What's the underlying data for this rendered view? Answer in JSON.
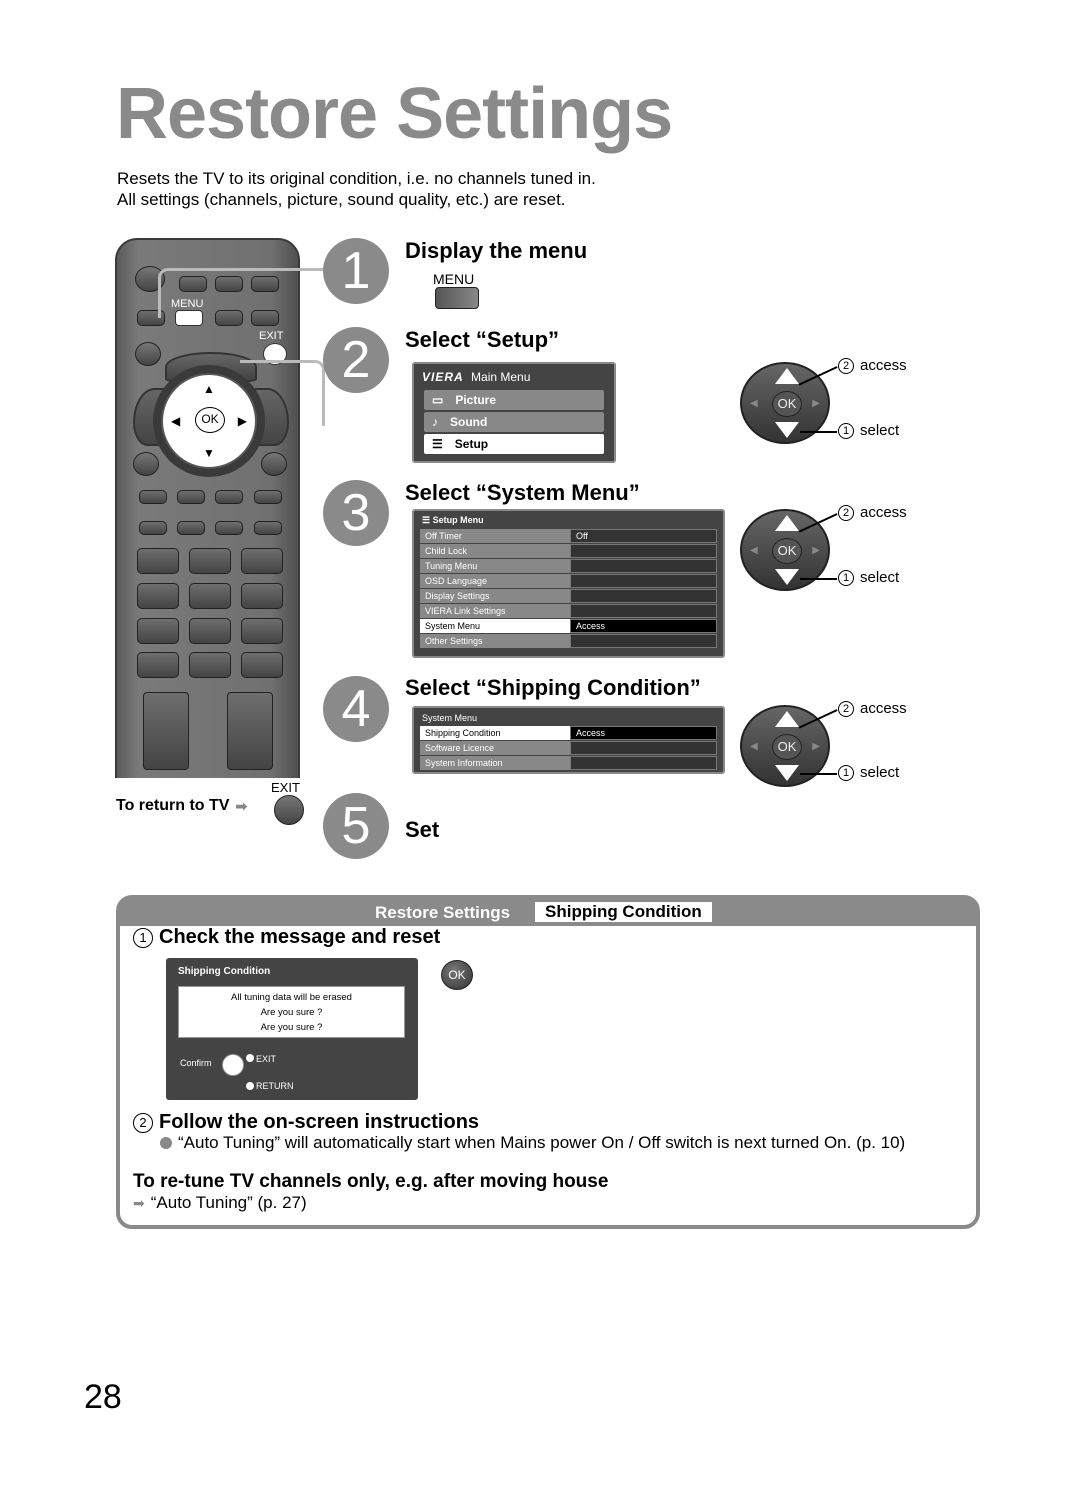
{
  "page": {
    "title": "Restore Settings",
    "intro": [
      "Resets the TV to its original condition, i.e. no channels tuned in.",
      "All settings (channels, picture, sound quality, etc.) are reset."
    ],
    "page_number": "28"
  },
  "remote": {
    "menu_label": "MENU",
    "exit_label": "EXIT",
    "ok_label": "OK",
    "return_to_tv": "To return to TV",
    "return_exit_label": "EXIT"
  },
  "steps": [
    {
      "number": "1",
      "title": "Display the menu",
      "key_label": "MENU"
    },
    {
      "number": "2",
      "title": "Select “Setup”"
    },
    {
      "number": "3",
      "title": "Select “System Menu”"
    },
    {
      "number": "4",
      "title": "Select “Shipping Condition”"
    },
    {
      "number": "5",
      "title": "Set"
    }
  ],
  "main_menu": {
    "brand": "VIERA",
    "title": "Main Menu",
    "items": [
      {
        "icon": "picture-icon",
        "label": "Picture"
      },
      {
        "icon": "sound-icon",
        "label": "Sound"
      },
      {
        "icon": "setup-icon",
        "label": "Setup",
        "selected": true
      }
    ]
  },
  "setup_menu": {
    "title": "Setup Menu",
    "rows": [
      {
        "label": "Off Timer",
        "value": "Off"
      },
      {
        "label": "Child Lock",
        "value": ""
      },
      {
        "label": "Tuning Menu",
        "value": ""
      },
      {
        "label": "OSD Language",
        "value": ""
      },
      {
        "label": "Display Settings",
        "value": ""
      },
      {
        "label": "VIERA Link Settings",
        "value": ""
      },
      {
        "label": "System Menu",
        "value": "Access",
        "selected": true
      },
      {
        "label": "Other Settings",
        "value": ""
      }
    ]
  },
  "system_menu": {
    "title": "System Menu",
    "rows": [
      {
        "label": "Shipping Condition",
        "value": "Access",
        "selected": true
      },
      {
        "label": "Software Licence",
        "value": ""
      },
      {
        "label": "System Information",
        "value": ""
      }
    ]
  },
  "control_pad": {
    "ok_label": "OK",
    "access_num": "2",
    "access_label": "access",
    "select_num": "1",
    "select_label": "select"
  },
  "box": {
    "header_main": "Restore Settings",
    "header_sub": "Shipping Condition",
    "step1_num": "1",
    "step1_title": "Check the message and reset",
    "dialog": {
      "title": "Shipping Condition",
      "lines": [
        "All tuning data will be erased",
        "Are you sure ?",
        "Are you sure ?"
      ],
      "confirm": "Confirm",
      "exit": "EXIT",
      "return": "RETURN"
    },
    "ok_button": "OK",
    "step2_num": "2",
    "step2_title": "Follow the on-screen instructions",
    "step2_note": "“Auto Tuning” will automatically start when Mains power On / Off switch is next turned On. (p. 10)",
    "retune_title": "To re-tune TV channels only, e.g. after moving house",
    "retune_link": "“Auto Tuning” (p. 27)"
  }
}
